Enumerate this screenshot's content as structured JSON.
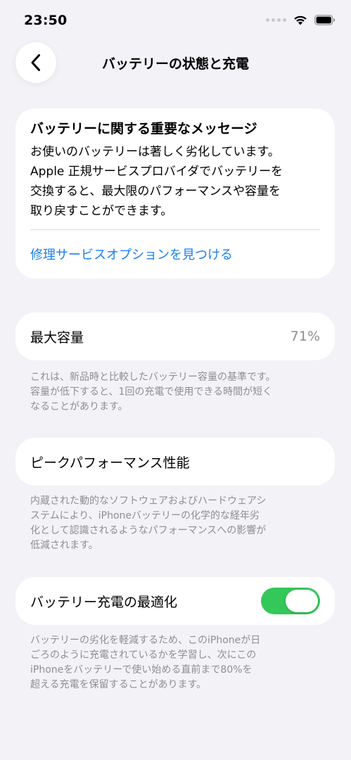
{
  "status_bar": {
    "time": "23:50"
  },
  "nav": {
    "title": "バッテリーの状態と充電"
  },
  "message_card": {
    "title": "バッテリーに関する重要なメッセージ",
    "body": "お使いのバッテリーは著しく劣化しています。\nApple 正規サービスプロバイダでバッテリーを\n交換すると、最大限のパフォーマンスや容量を\n取り戻すことができます。",
    "link": "修理サービスオプションを見つける"
  },
  "max_capacity": {
    "label": "最大容量",
    "value": "71%",
    "footnote": "これは、新品時と比較したバッテリー容量の基準です。\n容量が低下すると、1回の充電で使用できる時間が短く\nなることがあります。"
  },
  "peak_performance": {
    "label": "ピークパフォーマンス性能",
    "footnote": "内蔵された動的なソフトウェアおよびハードウェアシ\nステムにより、iPhoneバッテリーの化学的な経年劣\n化として認識されるようなパフォーマンスへの影響が\n低減されます。"
  },
  "optimized_charging": {
    "label": "バッテリー充電の最適化",
    "enabled": true,
    "footnote": "バッテリーの劣化を軽減するため、このiPhoneが日\nごろのように充電されているかを学習し、次にこの\niPhoneをバッテリーで使い始める直前まで80%を\n超える充電を保留することがあります。"
  },
  "colors": {
    "background": "#f2f2f7",
    "link": "#1c7ef0",
    "toggle_on": "#34c759",
    "secondary_text": "#8e8e93"
  },
  "icons": [
    "wifi-icon",
    "battery-icon",
    "chevron-left-icon",
    "signal-icon"
  ]
}
